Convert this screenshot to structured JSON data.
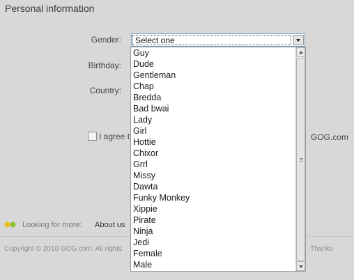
{
  "section": {
    "title": "Personal information"
  },
  "form": {
    "gender_label": "Gender:",
    "birthday_label": "Birthday:",
    "country_label": "Country:",
    "gender_select": {
      "selected": "Select one",
      "options": [
        "Guy",
        "Dude",
        "Gentleman",
        "Chap",
        "Bredda",
        "Bad bwai",
        "Lady",
        "Girl",
        "Hottie",
        "Chixor",
        "Grrl",
        "Missy",
        "Dawta",
        "Funky Monkey",
        "Xippie",
        "Pirate",
        "Ninja",
        "Jedi",
        "Female",
        "Male"
      ]
    },
    "agree_text": "I agree t",
    "agree_tail": "GOG.com"
  },
  "footer": {
    "looking_for_more": "Looking for more:",
    "about_link": "About us",
    "copyright": "Copyright © 2010 GOG.com. All rights",
    "thanks": "Thanks"
  },
  "colors": {
    "background": "#d8d8d8",
    "select_border": "#7a9bb5"
  },
  "icons": [
    "chevron-down-icon",
    "scroll-up-icon",
    "scroll-down-icon",
    "gog-dots-icon"
  ]
}
